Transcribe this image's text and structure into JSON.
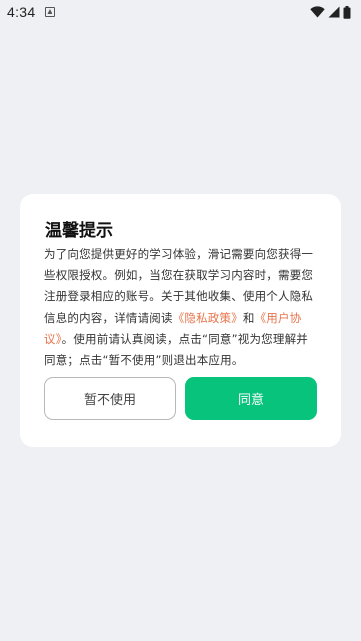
{
  "status_bar": {
    "time": "4:34",
    "icons": [
      "notification-icon",
      "wifi-icon",
      "signal-icon",
      "battery-icon"
    ]
  },
  "dialog": {
    "title": "温馨提示",
    "body_part1": "为了向您提供更好的学习体验，滑记需要向您获得一些权限授权。例如，当您在获取学习内容时，需要您注册登录相应的账号。关于其他收集、使用个人隐私信息的内容，详情请阅读",
    "privacy_link": "《隐私政策》",
    "body_and": "和",
    "terms_link": "《用户协议》",
    "body_part2": "。使用前请认真阅读，点击“同意”视为您理解并同意；点击“暂不使用”则退出本应用。",
    "decline_label": "暂不使用",
    "agree_label": "同意"
  },
  "colors": {
    "background": "#eff0f4",
    "accent": "#08c37c",
    "link": "#e8734a"
  }
}
